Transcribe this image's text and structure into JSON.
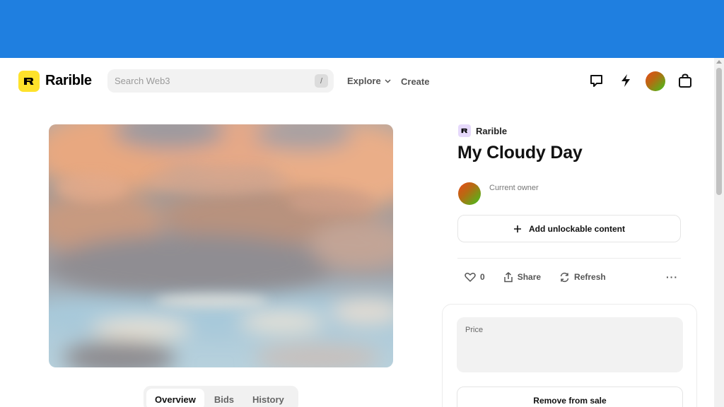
{
  "brand": {
    "name": "Rarible",
    "accent": "#fee22b",
    "topbar_color": "#1f7fe0"
  },
  "search": {
    "placeholder": "Search Web3",
    "shortcut": "/"
  },
  "nav": {
    "explore": "Explore",
    "create": "Create"
  },
  "header_icons": [
    "chat-icon",
    "lightning-icon",
    "avatar",
    "bag-icon"
  ],
  "item": {
    "collection": "Rarible",
    "title": "My Cloudy Day",
    "owner_label": "Current owner",
    "unlock_label": "Add unlockable content",
    "likes": "0",
    "share_label": "Share",
    "refresh_label": "Refresh",
    "more_label": "···"
  },
  "tabs": [
    "Overview",
    "Bids",
    "History"
  ],
  "sale": {
    "price_label": "Price",
    "remove_label": "Remove from sale"
  }
}
